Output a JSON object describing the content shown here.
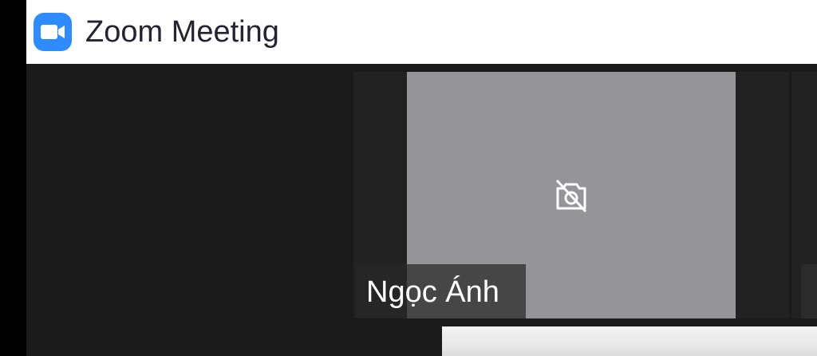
{
  "window": {
    "title": "Zoom Meeting",
    "app_icon": "zoom-camera-icon",
    "brand_color": "#2d8cff"
  },
  "gallery": {
    "tiles": [
      {
        "participant_name": "Ngọc Ánh",
        "video_status_icon": "camera-off-icon"
      }
    ]
  }
}
